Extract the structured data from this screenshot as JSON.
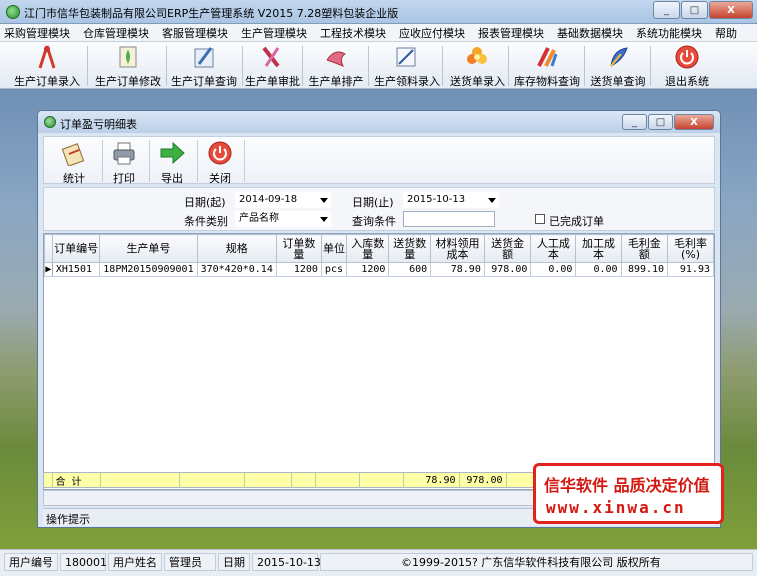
{
  "window": {
    "title": "江门市信华包装制品有限公司ERP生产管理系统  V2015  7.28塑料包装企业版",
    "controls": [
      "_",
      "□",
      "X"
    ]
  },
  "menu": [
    "采购管理模块",
    "仓库管理模块",
    "客服管理模块",
    "生产管理模块",
    "工程技术模块",
    "应收应付模块",
    "报表管理模块",
    "基础数据模块",
    "系统功能模块",
    "帮助"
  ],
  "toolbar": [
    {
      "label": "生产订单录入",
      "icon": "compass-icon"
    },
    {
      "label": "生产订单修改",
      "icon": "plant-pen-icon"
    },
    {
      "label": "生产订单查询",
      "icon": "book-pen-icon"
    },
    {
      "label": "生产单审批",
      "icon": "tool-icon"
    },
    {
      "label": "生产单排产",
      "icon": "bird-icon"
    },
    {
      "label": "生产领料录入",
      "icon": "pencil-icon"
    },
    {
      "label": "送货单录入",
      "icon": "flower-icon"
    },
    {
      "label": "库存物料查询",
      "icon": "tools-icon"
    },
    {
      "label": "送货单查询",
      "icon": "feather-icon"
    },
    {
      "label": "退出系统",
      "icon": "power-icon"
    }
  ],
  "inner": {
    "title": "订单盈亏明细表",
    "toolbar": [
      {
        "label": "统计",
        "icon": "clipboard-icon"
      },
      {
        "label": "打印",
        "icon": "printer-icon"
      },
      {
        "label": "导出",
        "icon": "arrow-right-icon"
      },
      {
        "label": "关闭",
        "icon": "power-icon"
      }
    ],
    "filter": {
      "date_start_label": "日期(起)",
      "date_start_value": "2014-09-18",
      "date_end_label": "日期(止)",
      "date_end_value": "2015-10-13",
      "category_label": "条件类别",
      "category_value": "产品名称",
      "query_label": "查询条件",
      "query_value": "",
      "completed_label": "已完成订单"
    },
    "grid": {
      "columns": [
        "订单编号",
        "生产单号",
        "规格",
        "订单数量",
        "单位",
        "入库数量",
        "送货数量",
        "材料领用\n成本",
        "送货金额",
        "人工成本",
        "加工成本",
        "毛利金额",
        "毛利率\n(%)"
      ],
      "rows": [
        [
          "XH1501",
          "18PM20150909001",
          "370*420*0.14",
          "1200",
          "pcs",
          "1200",
          "600",
          "78.90",
          "978.00",
          "0.00",
          "0.00",
          "899.10",
          "91.93"
        ]
      ]
    },
    "totals": {
      "label": "合  计",
      "material_cost": "78.90",
      "delivery_amount": "978.00"
    },
    "op_hint": "操作提示"
  },
  "watermark": {
    "line1": "信华软件 品质决定价值",
    "line2": "www.xinwa.cn"
  },
  "status": {
    "user_id_label": "用户编号",
    "user_id": "180001",
    "user_name_label": "用户姓名",
    "user_name": "管理员",
    "date_label": "日期",
    "date": "2015-10-13",
    "copyright": "©1999-2015?  广东信华软件科技有限公司  版权所有"
  }
}
